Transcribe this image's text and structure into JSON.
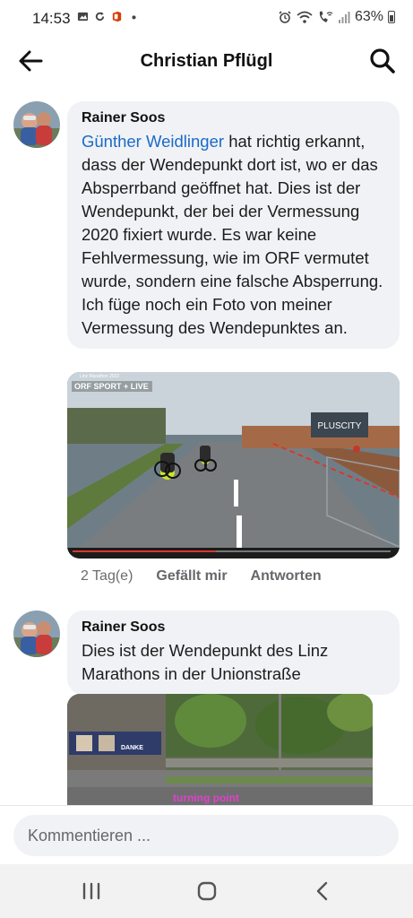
{
  "status_bar": {
    "time": "14:53",
    "battery": "63%"
  },
  "header": {
    "title": "Christian Pflügl"
  },
  "comments": [
    {
      "author": "Rainer Soos",
      "mention": "Günther Weidlinger",
      "text": " hat richtig erkannt, dass der Wendepunkt dort ist, wo er das Absperrband geöffnet hat. Dies ist der Wendepunkt, der bei der Vermessung 2020 fixiert wurde. Es war keine Fehlvermessung, wie im ORF vermutet wurde, sondern eine falsche Absperrung. Ich füge noch ein Foto von meiner Vermessung des Wendepunktes an.",
      "photo": {
        "overlay_channel": "ORF SPORT + LIVE",
        "overlay_title": "Linz Marathon 2022",
        "billboard": "PLUSCITY"
      },
      "time": "2 Tag(e)",
      "like_label": "Gefällt mir",
      "reply_label": "Antworten"
    },
    {
      "author": "Rainer Soos",
      "text": "Dies ist der Wendepunkt des Linz Marathons in der Unionstraße",
      "photo": {
        "caption": "turning point",
        "billboard": "DANKE"
      }
    }
  ],
  "composer": {
    "placeholder": "Kommentieren ..."
  },
  "icons": {
    "back": "arrow-left-icon",
    "search": "search-icon",
    "nav_recent": "recent-apps-icon",
    "nav_home": "home-icon",
    "nav_back": "nav-back-icon"
  },
  "colors": {
    "mention": "#1b6ac9",
    "bubble": "#f0f2f5",
    "caption": "#e040d0"
  }
}
